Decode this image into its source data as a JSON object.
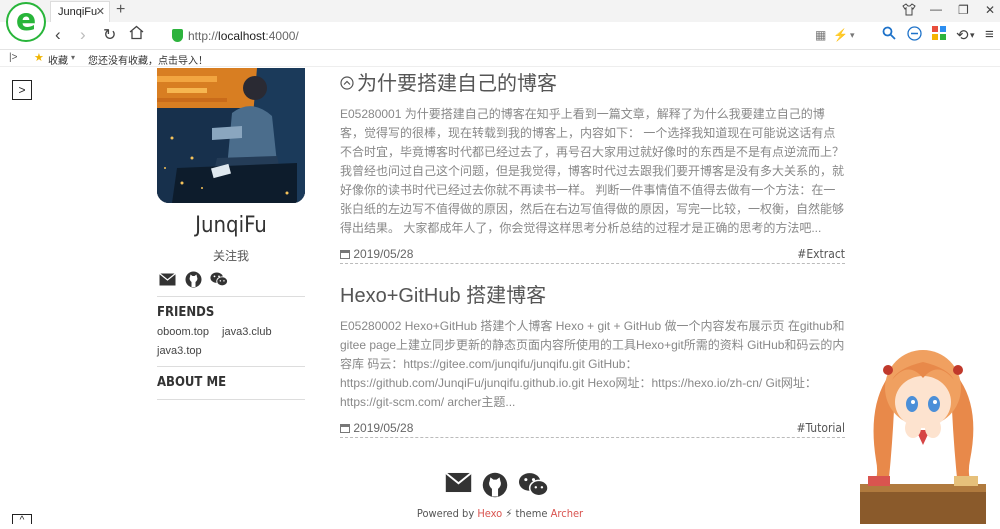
{
  "browser": {
    "tab_title": "JunqiFu",
    "url_prefix": "http://",
    "url_host": "localhost",
    "url_rest": ":4000/",
    "favorites_label": "收藏",
    "favorites_hint": "您还没有收藏，点击导入！"
  },
  "sidebar": {
    "author_name": "JunqiFu",
    "follow_label": "关注我",
    "friends_heading": "FRIENDS",
    "friends_links": [
      "oboom.top",
      "java3.club",
      "java3.top"
    ],
    "about_heading": "ABOUT ME"
  },
  "posts": [
    {
      "title": "为什要搭建自己的博客",
      "excerpt": "E05280001 为什要搭建自己的博客在知乎上看到一篇文章，解释了为什么我要建立自己的博客，觉得写的很棒，现在转载到我的博客上，内容如下： 一个选择我知道现在可能说这话有点不合时宜，毕竟博客时代都已经过去了，再号召大家用过就好像时的东西是不是有点逆流而上？ 我曾经也问过自己这个问题，但是我觉得，博客时代过去跟我们要开博客是没有多大关系的，就好像你的读书时代已经过去你就不再读书一样。 判断一件事情值不值得去做有一个方法：在一张白纸的左边写不值得做的原因，然后在右边写值得做的原因，写完一比较，一权衡，自然能够得出结果。 大家都成年人了，你会觉得这样思考分析总结的过程才是正确的思考的方法吧...",
      "date": "2019/05/28",
      "tag": "#Extract"
    },
    {
      "title": "Hexo+GitHub 搭建博客",
      "excerpt": "E05280002 Hexo+GitHub 搭建个人博客 Hexo + git + GitHub 做一个内容发布展示页 在github和gitee page上建立同步更新的静态页面内容所使用的工具Hexo+git所需的资料 GitHub和码云的内容库 码云：https://gitee.com/junqifu/junqifu.git GitHub：https://github.com/JunqiFu/junqifu.github.io.git Hexo网址：https://hexo.io/zh-cn/ Git网址：https://git-scm.com/ archer主题...",
      "date": "2019/05/28",
      "tag": "#Tutorial"
    }
  ],
  "footer": {
    "powered_by": "Powered by",
    "hexo": "Hexo",
    "theme_label": "theme",
    "archer": "Archer"
  },
  "colors": {
    "accent_red": "#d9534f",
    "browser_green": "#28b53a"
  }
}
